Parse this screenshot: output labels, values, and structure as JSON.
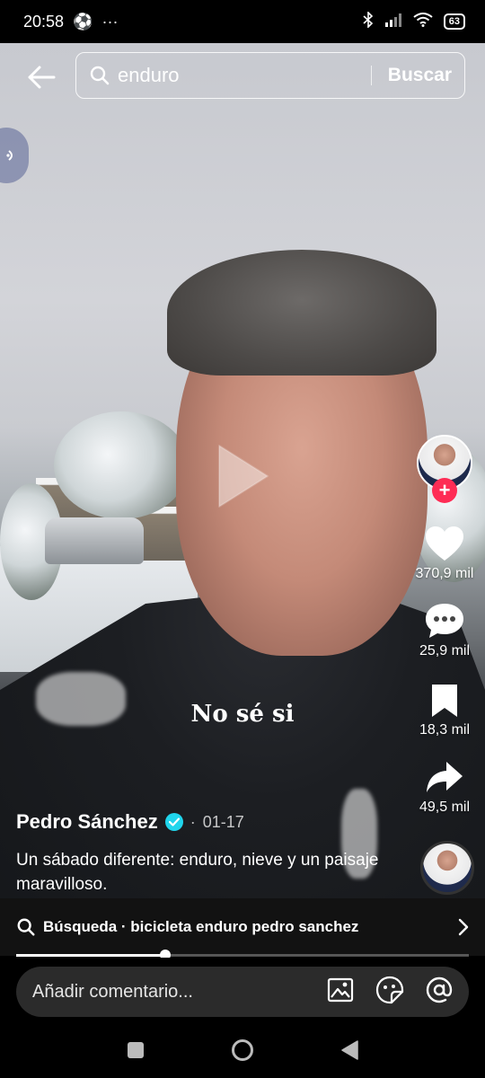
{
  "status_bar": {
    "time": "20:58",
    "notification_icons": [
      "soccer-ball-icon",
      "more-icon"
    ],
    "battery": "63"
  },
  "search": {
    "query": "enduro",
    "submit_label": "Buscar"
  },
  "video": {
    "caption_overlay": "No sé si",
    "creator": "Pedro Sánchez",
    "verified": true,
    "date": "01-17",
    "separator": "·",
    "description": "Un sábado diferente: enduro, nieve y un paisaje maravilloso."
  },
  "actions": {
    "likes": "370,9 mil",
    "comments": "25,9 mil",
    "saves": "18,3 mil",
    "shares": "49,5 mil"
  },
  "suggestion": {
    "label": "Búsqueda · bicicleta enduro pedro sanchez"
  },
  "playback": {
    "progress": 0.33
  },
  "comment": {
    "placeholder": "Añadir comentario..."
  },
  "colors": {
    "follow_badge": "#fe2c55",
    "verified": "#20d5ec"
  }
}
